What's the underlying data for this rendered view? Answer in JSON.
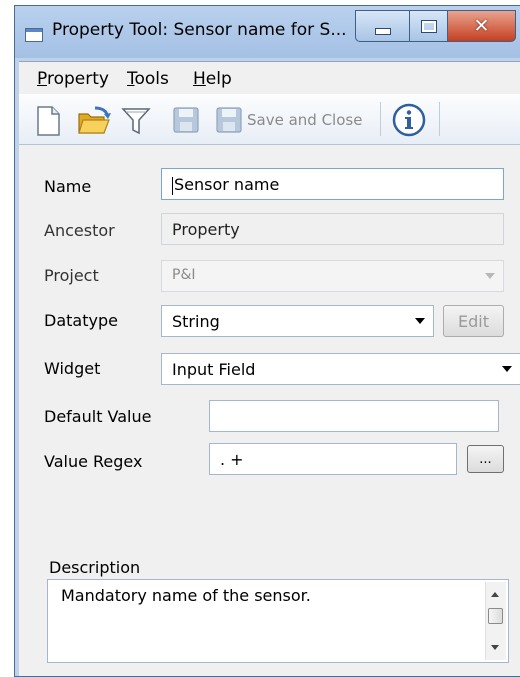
{
  "window": {
    "title": "Property Tool: Sensor name for S..."
  },
  "menu": {
    "items": [
      "Property",
      "Tools",
      "Help"
    ]
  },
  "toolbar": {
    "save_close_label": "Save and Close",
    "icons": [
      "new-document-icon",
      "open-folder-icon",
      "filter-icon",
      "save-icon",
      "save-and-close-icon",
      "info-icon"
    ]
  },
  "form": {
    "name": {
      "label": "Name",
      "value": "Sensor name"
    },
    "ancestor": {
      "label": "Ancestor",
      "value": "Property"
    },
    "project": {
      "label": "Project",
      "value": "P&I"
    },
    "datatype": {
      "label": "Datatype",
      "value": "String",
      "edit_label": "Edit"
    },
    "widget": {
      "label": "Widget",
      "value": "Input Field"
    },
    "default_value": {
      "label": "Default Value",
      "value": ""
    },
    "value_regex": {
      "label": "Value Regex",
      "value": ". +",
      "browse_label": "..."
    },
    "description": {
      "label": "Description",
      "value": "Mandatory name of the sensor."
    }
  },
  "colors": {
    "titlebar": "#b9d1ee",
    "close_button": "#c53f21",
    "panel": "#f0f0f0",
    "icon_blue": "#3d74c2",
    "folder_yellow": "#f2c23a"
  }
}
